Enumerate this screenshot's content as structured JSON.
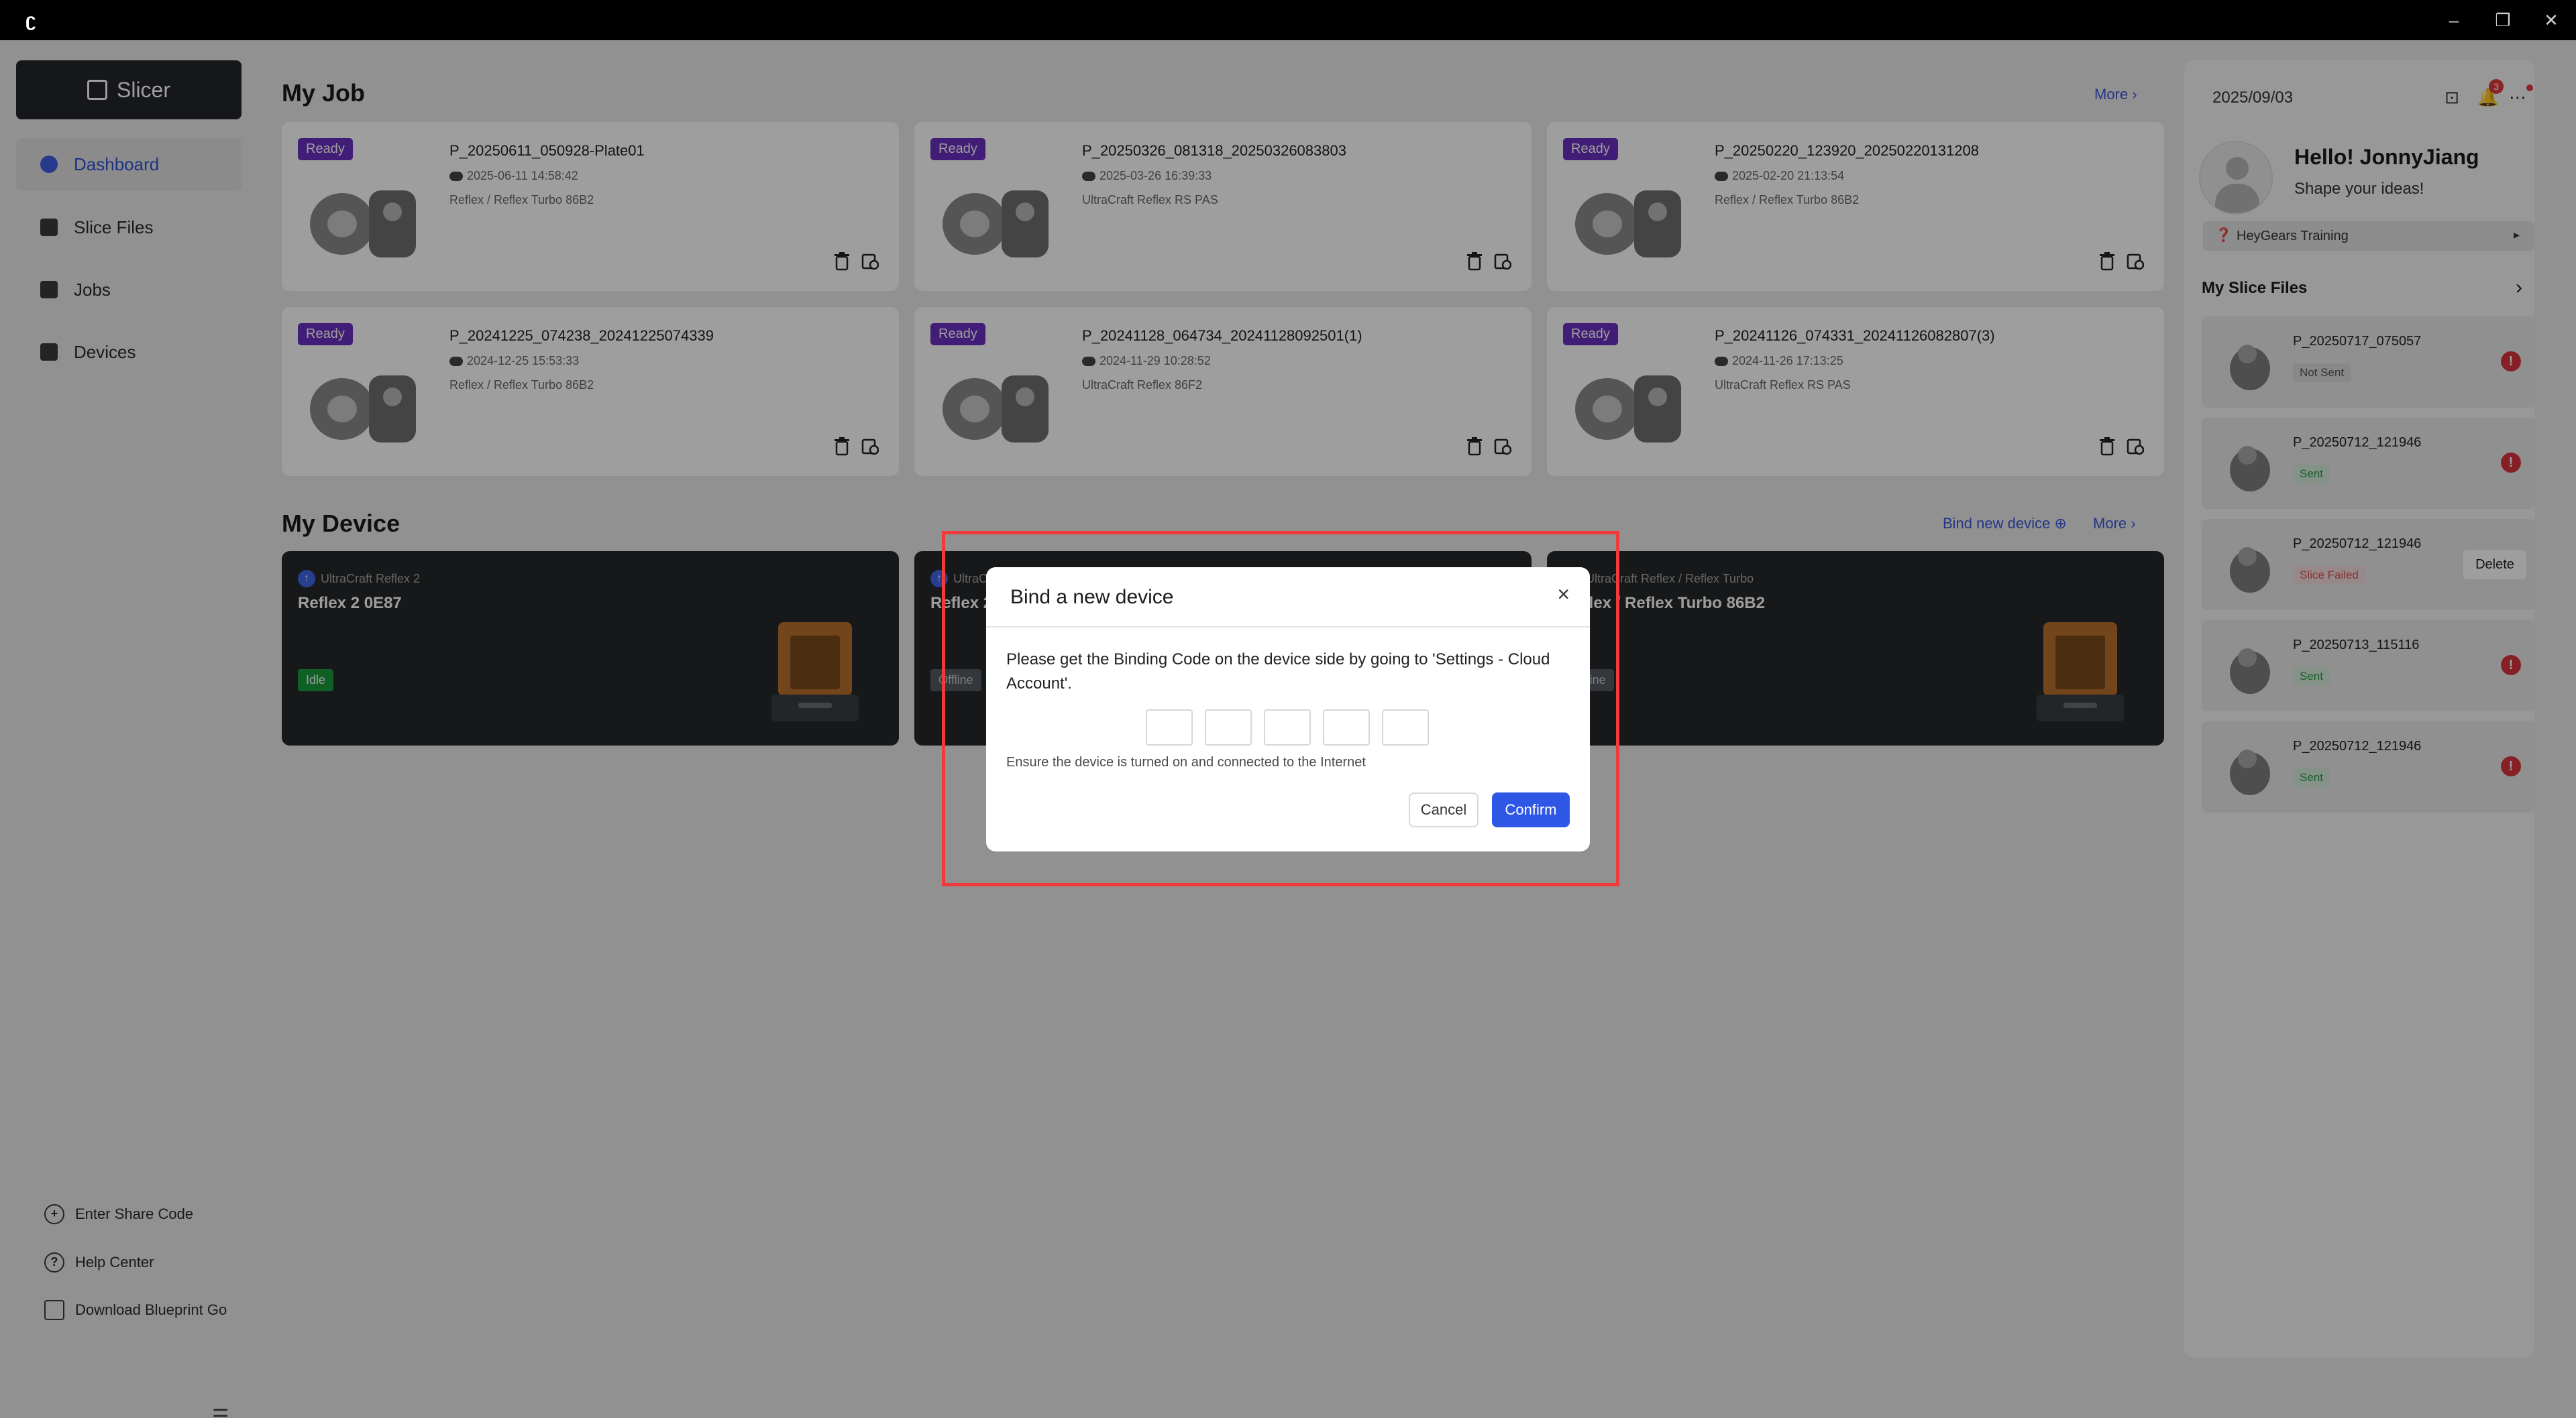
{
  "titlebar": {
    "logo": "ʗ",
    "minimize": "–",
    "restore": "❐",
    "close": "✕"
  },
  "sidebar": {
    "slicer_label": "Slicer",
    "nav": [
      {
        "label": "Dashboard",
        "icon": "dashboard-icon"
      },
      {
        "label": "Slice Files",
        "icon": "layers-icon"
      },
      {
        "label": "Jobs",
        "icon": "list-icon"
      },
      {
        "label": "Devices",
        "icon": "printer-icon"
      }
    ],
    "utils": [
      {
        "label": "Enter Share Code",
        "icon": "plus-circle-icon"
      },
      {
        "label": "Help Center",
        "icon": "help-icon"
      },
      {
        "label": "Download Blueprint Go",
        "icon": "laptop-icon"
      }
    ]
  },
  "main": {
    "my_job_title": "My Job",
    "more": "More",
    "jobs": [
      {
        "badge": "Ready",
        "title": "P_20250611_050928-Plate01",
        "date": "2025-06-11 14:58:42",
        "printer": "Reflex / Reflex Turbo 86B2"
      },
      {
        "badge": "Ready",
        "title": "P_20250326_081318_20250326083803",
        "date": "2025-03-26 16:39:33",
        "printer": "UltraCraft Reflex RS PAS"
      },
      {
        "badge": "Ready",
        "title": "P_20250220_123920_20250220131208",
        "date": "2025-02-20 21:13:54",
        "printer": "Reflex / Reflex Turbo 86B2"
      },
      {
        "badge": "Ready",
        "title": "P_20241225_074238_20241225074339",
        "date": "2024-12-25 15:53:33",
        "printer": "Reflex / Reflex Turbo 86B2"
      },
      {
        "badge": "Ready",
        "title": "P_20241128_064734_20241128092501(1)",
        "date": "2024-11-29 10:28:52",
        "printer": "UltraCraft Reflex 86F2"
      },
      {
        "badge": "Ready",
        "title": "P_20241126_074331_20241126082807(3)",
        "date": "2024-11-26 17:13:25",
        "printer": "UltraCraft Reflex RS PAS"
      }
    ],
    "my_device_title": "My Device",
    "bind_new_device": "Bind new device",
    "devices": [
      {
        "model": "UltraCraft Reflex 2",
        "name": "Reflex 2 0E87",
        "status": "Idle"
      },
      {
        "model": "UltraCraft",
        "name": "Reflex 2",
        "status": "Offline"
      },
      {
        "model": "UltraCraft Reflex / Reflex Turbo",
        "name": "Reflex / Reflex Turbo 86B2",
        "status": "Offline"
      }
    ]
  },
  "right_panel": {
    "date": "2025/09/03",
    "notif_count": "3",
    "hello": "Hello! JonnyJiang",
    "tagline": "Shape your ideas!",
    "training": "HeyGears Training",
    "slice_files_title": "My Slice Files",
    "slice_files": [
      {
        "name": "P_20250717_075057",
        "status": "Not Sent"
      },
      {
        "name": "P_20250712_121946",
        "status": "Sent"
      },
      {
        "name": "P_20250712_121946",
        "status": "Slice Failed",
        "delete": "Delete"
      },
      {
        "name": "P_20250713_115116",
        "status": "Sent"
      },
      {
        "name": "P_20250712_121946",
        "status": "Sent"
      }
    ]
  },
  "modal": {
    "title": "Bind a new device",
    "close": "×",
    "description": "Please get the Binding Code on the device side by going to 'Settings - Cloud Account'.",
    "hint": "Ensure the device is turned on and connected to the Internet",
    "cancel": "Cancel",
    "confirm": "Confirm",
    "code_values": [
      "",
      "",
      "",
      "",
      ""
    ]
  }
}
